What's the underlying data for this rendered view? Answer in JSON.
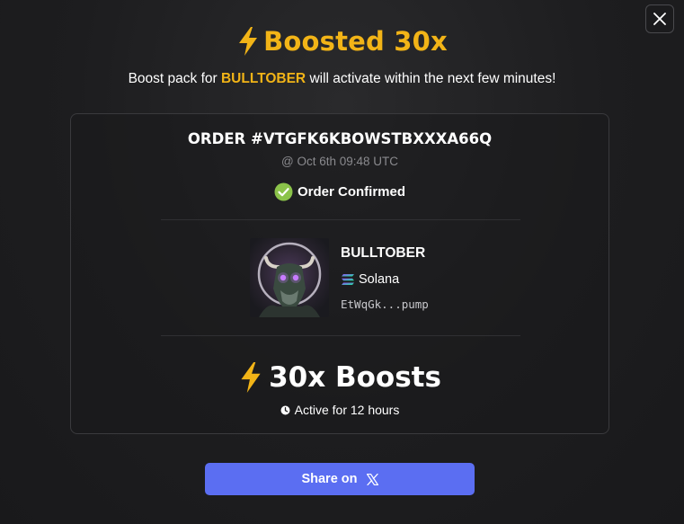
{
  "header": {
    "title": "Boosted 30x",
    "subtitle_prefix": "Boost pack for ",
    "subtitle_token": "BULLTOBER",
    "subtitle_suffix": " will activate within the next few minutes!"
  },
  "order": {
    "id": "ORDER #VTGFK6KBOWSTBXXXA66Q",
    "time": "@ Oct 6th 09:48 UTC",
    "status": "Order Confirmed"
  },
  "token": {
    "name": "BULLTOBER",
    "chain": "Solana",
    "address": "EtWqGk...pump",
    "image_icon": "bull-token-image"
  },
  "boost": {
    "label": "30x Boosts",
    "duration": "Active for 12 hours"
  },
  "share": {
    "label": "Share on"
  },
  "colors": {
    "accent": "#f2b417",
    "button": "#5b6ef2",
    "success": "#8bc34a",
    "background": "#1d1d1f"
  },
  "icons": {
    "close": "close-icon",
    "bolt": "lightning-bolt-icon",
    "check": "check-circle-icon",
    "chain": "solana-icon",
    "clock": "clock-icon",
    "share": "x-logo-icon"
  }
}
